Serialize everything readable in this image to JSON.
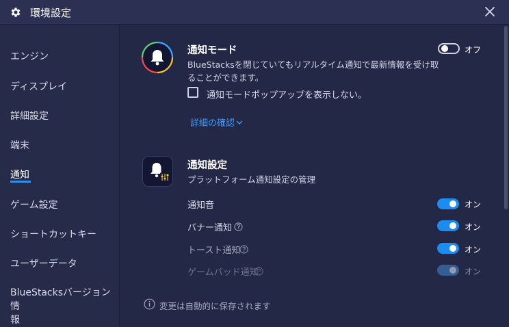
{
  "window": {
    "title": "環境設定"
  },
  "sidebar": {
    "items": [
      {
        "label": "エンジン"
      },
      {
        "label": "ディスプレイ"
      },
      {
        "label": "詳細設定"
      },
      {
        "label": "端末"
      },
      {
        "label": "通知"
      },
      {
        "label": "ゲーム設定"
      },
      {
        "label": "ショートカットキー"
      },
      {
        "label": "ユーザーデータ"
      },
      {
        "label_line1": "BlueStacksバージョン情",
        "label_line2": "報"
      }
    ],
    "active_index": 4
  },
  "notification_mode": {
    "title": "通知モード",
    "desc_line1": "BlueStacksを閉じていてもリアルタイム通知で最新情報を受け取",
    "desc_line2": "ることができます。",
    "toggle_label": "オフ",
    "toggle_state": "off",
    "checkbox_label": "通知モードポップアップを表示しない。",
    "checkbox_checked": false,
    "details_link": "詳細の確認",
    "icon": "bell-icon"
  },
  "notification_settings": {
    "title": "通知設定",
    "subtitle": "プラットフォーム通知設定の管理",
    "icon": "bell-settings-icon",
    "rows": [
      {
        "label": "通知音",
        "toggle_label": "オン",
        "state": "on",
        "help": false
      },
      {
        "label": "バナー通知",
        "toggle_label": "オン",
        "state": "on",
        "help": true
      },
      {
        "label": "トースト通知",
        "toggle_label": "オン",
        "state": "on",
        "help": true
      },
      {
        "label": "ゲームパッド通知",
        "toggle_label": "オン",
        "state": "disabled",
        "help": true
      }
    ]
  },
  "footer": {
    "text": "変更は自動的に保存されます",
    "icon": "info-icon"
  },
  "colors": {
    "accent": "#1c8cf0",
    "link": "#3d9cff",
    "background": "#232846"
  }
}
